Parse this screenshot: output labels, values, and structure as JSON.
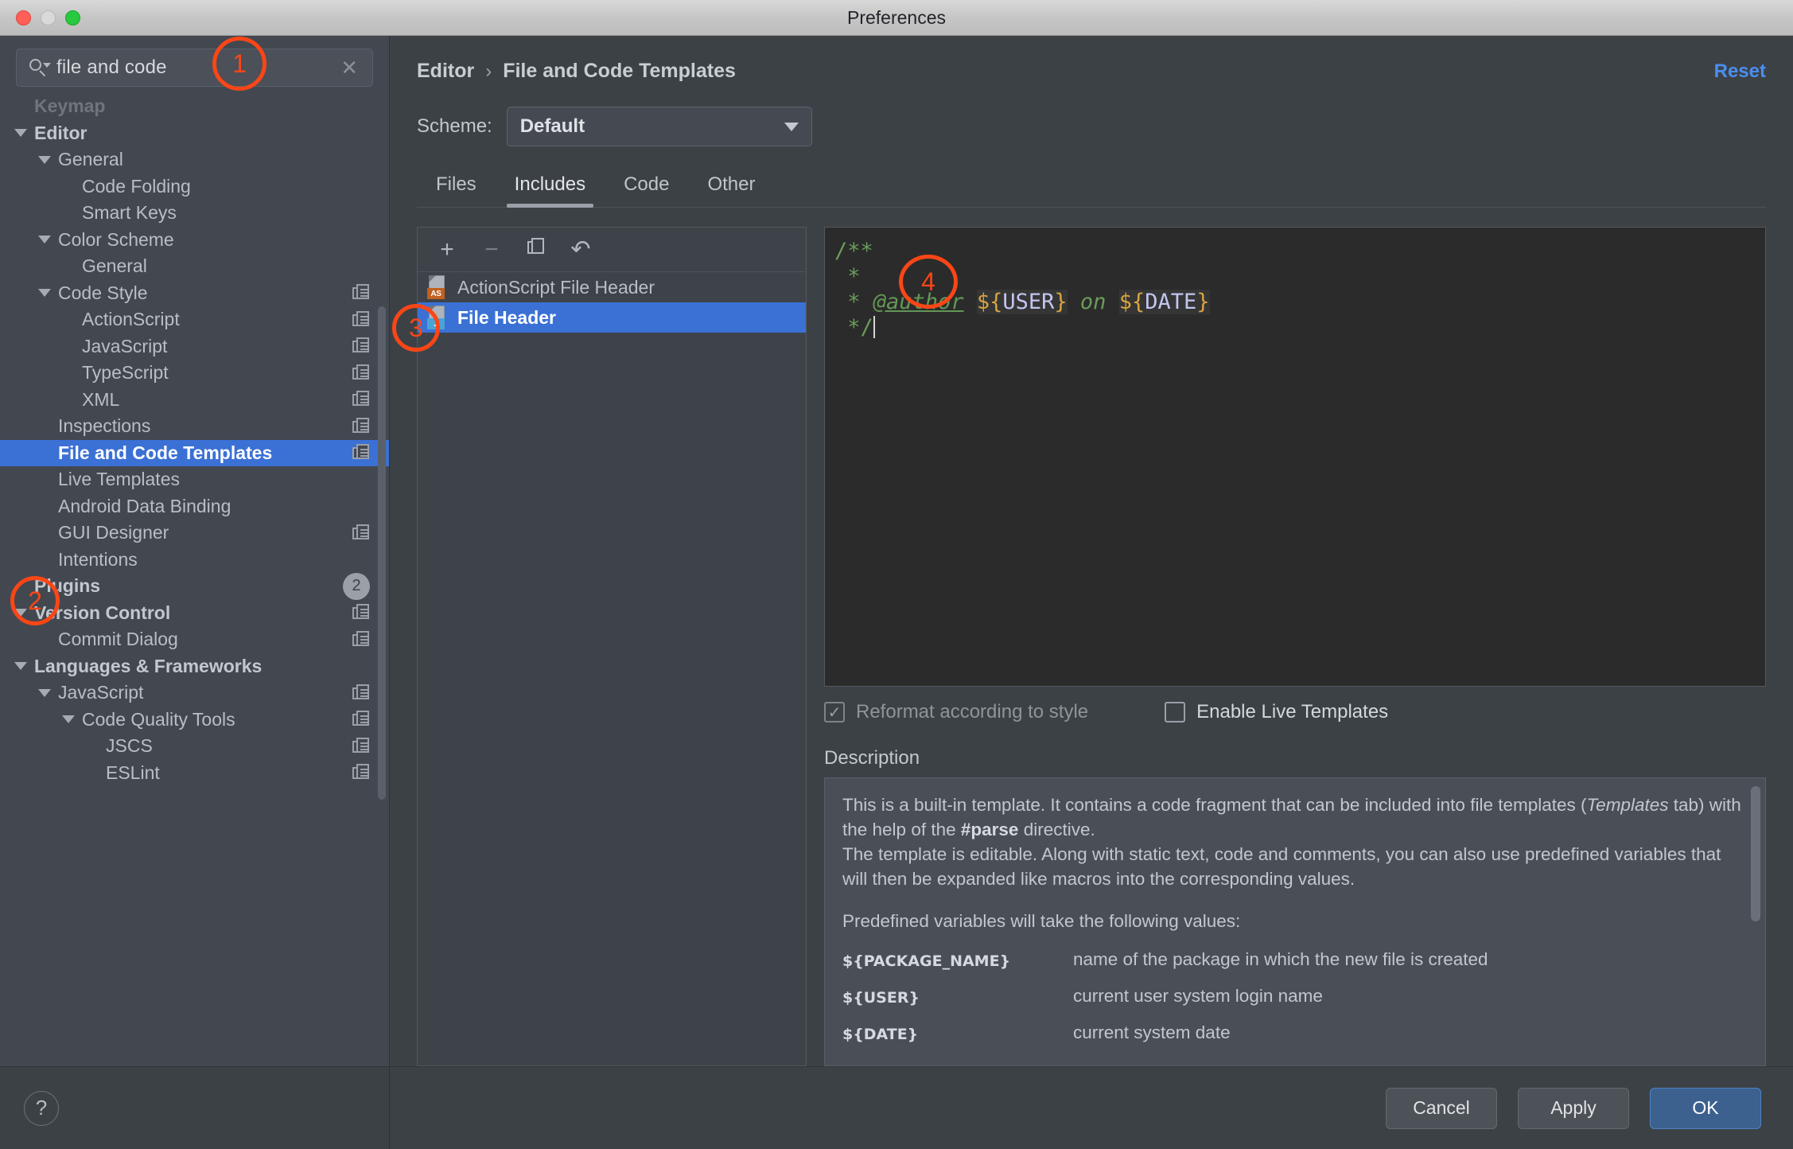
{
  "window": {
    "title": "Preferences"
  },
  "search": {
    "value": "file and code",
    "clear_icon": "close-icon"
  },
  "sidebar": {
    "items": [
      {
        "label": "Keymap",
        "indent": 0,
        "twisty": "none",
        "bold": true,
        "faded": true,
        "icon": "",
        "badge": ""
      },
      {
        "label": "Editor",
        "indent": 0,
        "twisty": "open",
        "bold": true,
        "faded": false,
        "icon": "",
        "badge": ""
      },
      {
        "label": "General",
        "indent": 1,
        "twisty": "open",
        "bold": false,
        "faded": false,
        "icon": "",
        "badge": ""
      },
      {
        "label": "Code Folding",
        "indent": 2,
        "twisty": "none",
        "bold": false,
        "faded": false,
        "icon": "",
        "badge": ""
      },
      {
        "label": "Smart Keys",
        "indent": 2,
        "twisty": "none",
        "bold": false,
        "faded": false,
        "icon": "",
        "badge": ""
      },
      {
        "label": "Color Scheme",
        "indent": 1,
        "twisty": "open",
        "bold": false,
        "faded": false,
        "icon": "",
        "badge": ""
      },
      {
        "label": "General",
        "indent": 2,
        "twisty": "none",
        "bold": false,
        "faded": false,
        "icon": "",
        "badge": ""
      },
      {
        "label": "Code Style",
        "indent": 1,
        "twisty": "open",
        "bold": false,
        "faded": false,
        "icon": "copy-icon",
        "badge": ""
      },
      {
        "label": "ActionScript",
        "indent": 2,
        "twisty": "none",
        "bold": false,
        "faded": false,
        "icon": "copy-icon",
        "badge": ""
      },
      {
        "label": "JavaScript",
        "indent": 2,
        "twisty": "none",
        "bold": false,
        "faded": false,
        "icon": "copy-icon",
        "badge": ""
      },
      {
        "label": "TypeScript",
        "indent": 2,
        "twisty": "none",
        "bold": false,
        "faded": false,
        "icon": "copy-icon",
        "badge": ""
      },
      {
        "label": "XML",
        "indent": 2,
        "twisty": "none",
        "bold": false,
        "faded": false,
        "icon": "copy-icon",
        "badge": ""
      },
      {
        "label": "Inspections",
        "indent": 1,
        "twisty": "none",
        "bold": false,
        "faded": false,
        "icon": "copy-icon",
        "badge": ""
      },
      {
        "label": "File and Code Templates",
        "indent": 1,
        "twisty": "none",
        "bold": false,
        "faded": false,
        "icon": "copy-icon",
        "badge": "",
        "selected": true
      },
      {
        "label": "Live Templates",
        "indent": 1,
        "twisty": "none",
        "bold": false,
        "faded": false,
        "icon": "",
        "badge": ""
      },
      {
        "label": "Android Data Binding",
        "indent": 1,
        "twisty": "none",
        "bold": false,
        "faded": false,
        "icon": "",
        "badge": ""
      },
      {
        "label": "GUI Designer",
        "indent": 1,
        "twisty": "none",
        "bold": false,
        "faded": false,
        "icon": "copy-icon",
        "badge": ""
      },
      {
        "label": "Intentions",
        "indent": 1,
        "twisty": "none",
        "bold": false,
        "faded": false,
        "icon": "",
        "badge": ""
      },
      {
        "label": "Plugins",
        "indent": 0,
        "twisty": "none",
        "bold": true,
        "faded": false,
        "icon": "",
        "badge": "2"
      },
      {
        "label": "Version Control",
        "indent": 0,
        "twisty": "open",
        "bold": true,
        "faded": false,
        "icon": "copy-icon",
        "badge": ""
      },
      {
        "label": "Commit Dialog",
        "indent": 1,
        "twisty": "none",
        "bold": false,
        "faded": false,
        "icon": "copy-icon",
        "badge": ""
      },
      {
        "label": "Languages & Frameworks",
        "indent": 0,
        "twisty": "open",
        "bold": true,
        "faded": false,
        "icon": "",
        "badge": ""
      },
      {
        "label": "JavaScript",
        "indent": 1,
        "twisty": "open",
        "bold": false,
        "faded": false,
        "icon": "copy-icon",
        "badge": ""
      },
      {
        "label": "Code Quality Tools",
        "indent": 2,
        "twisty": "open",
        "bold": false,
        "faded": false,
        "icon": "copy-icon",
        "badge": ""
      },
      {
        "label": "JSCS",
        "indent": 3,
        "twisty": "none",
        "bold": false,
        "faded": false,
        "icon": "copy-icon",
        "badge": ""
      },
      {
        "label": "ESLint",
        "indent": 3,
        "twisty": "none",
        "bold": false,
        "faded": false,
        "icon": "copy-icon",
        "badge": ""
      }
    ],
    "help_label": "?"
  },
  "header": {
    "breadcrumb": [
      "Editor",
      "File and Code Templates"
    ],
    "breadcrumb_separator": "›",
    "reset_label": "Reset"
  },
  "scheme": {
    "label": "Scheme:",
    "value": "Default"
  },
  "tabs": [
    {
      "label": "Files",
      "active": false
    },
    {
      "label": "Includes",
      "active": true
    },
    {
      "label": "Code",
      "active": false
    },
    {
      "label": "Other",
      "active": false
    }
  ],
  "list_toolbar": {
    "add": "+",
    "remove": "−",
    "copy": "copy-icon",
    "revert": "↶"
  },
  "templates": [
    {
      "label": "ActionScript File Header",
      "tag": "AS",
      "selected": false
    },
    {
      "label": "File Header",
      "tag": "J",
      "selected": true
    }
  ],
  "code": {
    "line1": "/**",
    "line2_star": " *",
    "line3_star": " * ",
    "line3_tag": "@author",
    "line3_user_open": "${",
    "line3_user_name": "USER",
    "line3_user_close": "}",
    "line3_on": " on ",
    "line3_date_open": "${",
    "line3_date_name": "DATE",
    "line3_date_close": "}",
    "line4": " */"
  },
  "checkboxes": [
    {
      "label": "Reformat according to style",
      "checked": true,
      "mark": "✓"
    },
    {
      "label": "Enable Live Templates",
      "checked": false,
      "mark": ""
    }
  ],
  "description": {
    "title": "Description",
    "p1_a": "This is a built-in template. It contains a code fragment that can be included into file templates (",
    "p1_em": "Templates",
    "p1_b": " tab) with the help of the ",
    "p1_bold": "#parse",
    "p1_c": " directive.",
    "p2": "The template is editable. Along with static text, code and comments, you can also use predefined variables that will then be expanded like macros into the corresponding values.",
    "p3": "Predefined variables will take the following values:",
    "variables": [
      {
        "name": "${PACKAGE_NAME}",
        "desc": "name of the package in which the new file is created"
      },
      {
        "name": "${USER}",
        "desc": "current user system login name"
      },
      {
        "name": "${DATE}",
        "desc": "current system date"
      }
    ]
  },
  "footer": {
    "cancel": "Cancel",
    "apply": "Apply",
    "ok": "OK"
  },
  "annotations": [
    {
      "id": "1",
      "label": "1"
    },
    {
      "id": "2",
      "label": "2"
    },
    {
      "id": "3",
      "label": "3"
    },
    {
      "id": "4",
      "label": "4"
    }
  ],
  "colors": {
    "accent_blue": "#3b71d5",
    "link_blue": "#4b8ef0",
    "annotation_orange": "#fa4616",
    "sidebar_bg": "#434850",
    "panel_bg": "#3c4146",
    "code_bg": "#2b2b2b"
  }
}
